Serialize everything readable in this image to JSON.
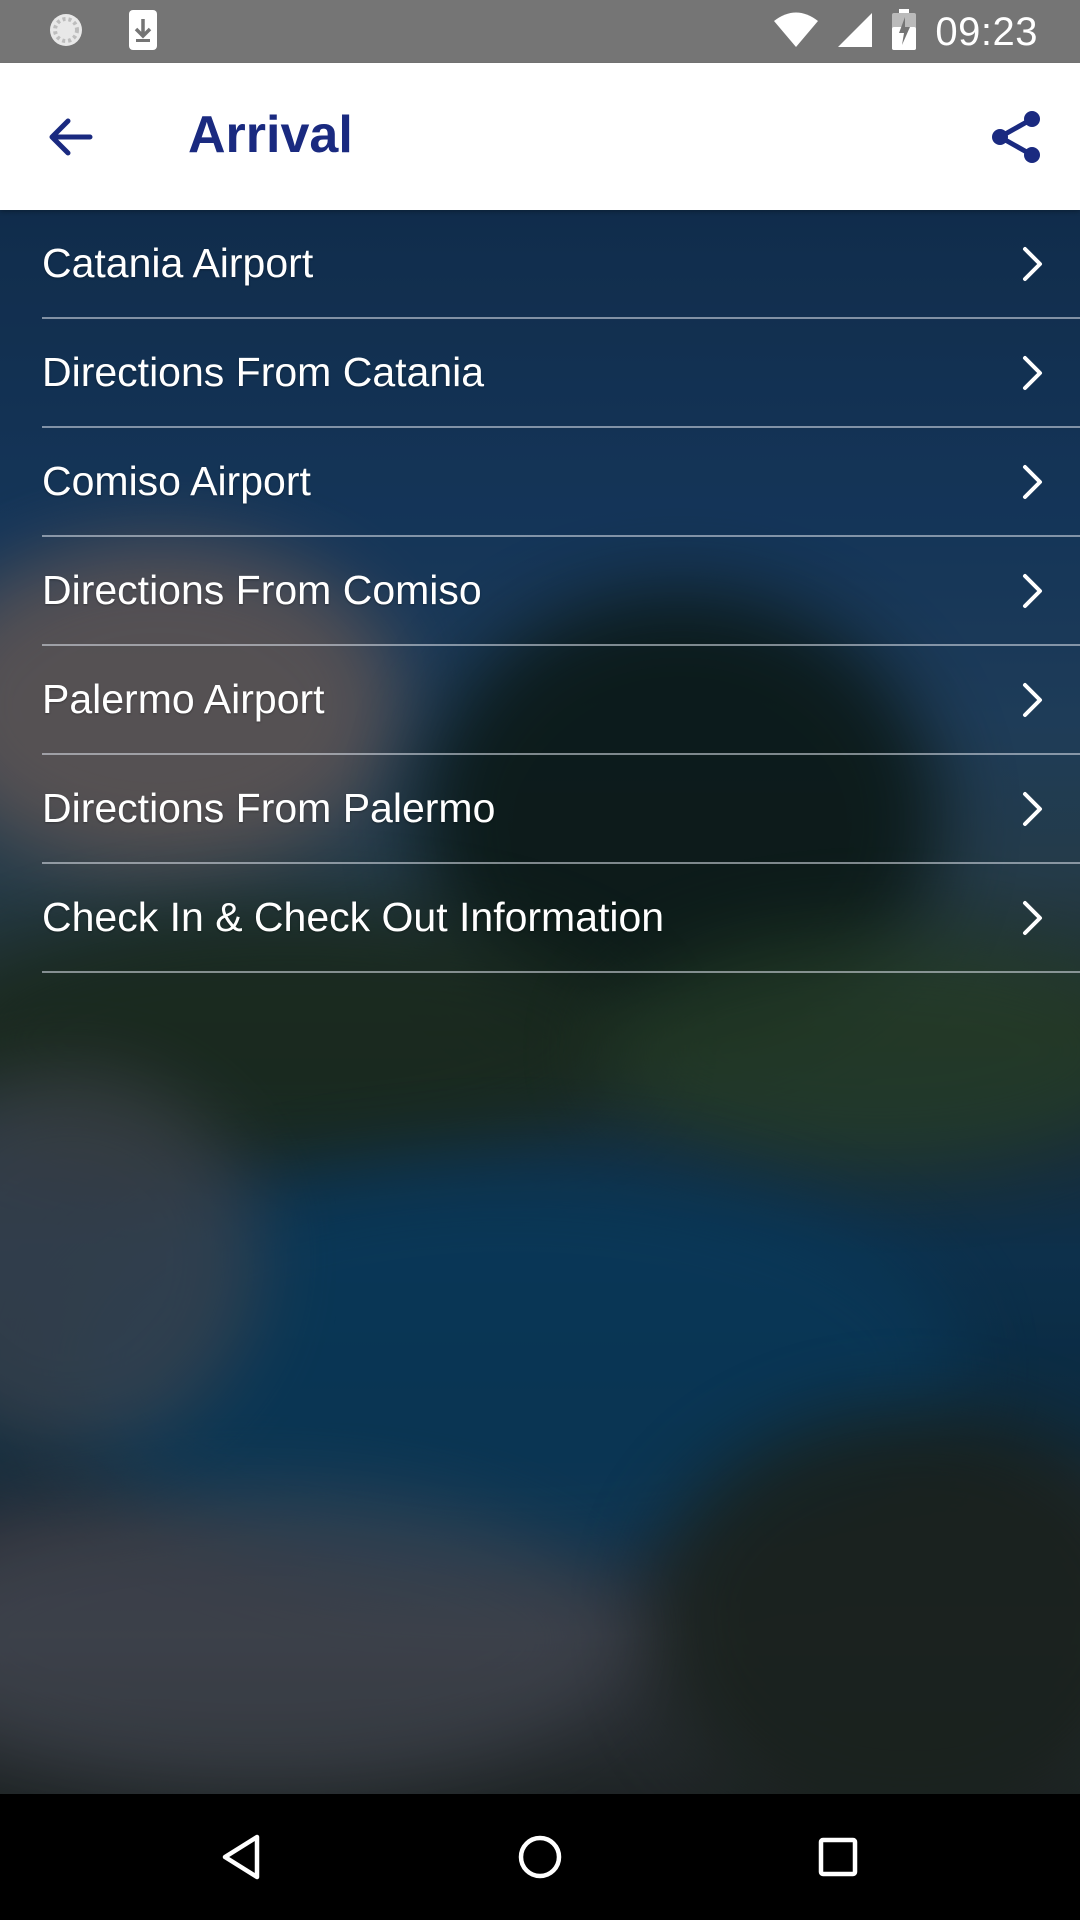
{
  "status_bar": {
    "time": "09:23",
    "icons": [
      "sync-icon",
      "download-icon",
      "wifi-icon",
      "signal-icon",
      "battery-icon"
    ]
  },
  "app_bar": {
    "title": "Arrival",
    "back_icon": "arrow-back-icon",
    "share_icon": "share-icon",
    "color": "#1a2a80"
  },
  "menu": {
    "items": [
      {
        "label": "Catania Airport"
      },
      {
        "label": "Directions From Catania"
      },
      {
        "label": "Comiso Airport"
      },
      {
        "label": "Directions From Comiso"
      },
      {
        "label": "Palermo Airport"
      },
      {
        "label": "Directions From Palermo"
      },
      {
        "label": "Check In & Check Out Information"
      }
    ],
    "chevron_icon": "chevron-right-icon"
  },
  "nav_bar": {
    "icons": [
      "back-triangle-icon",
      "home-circle-icon",
      "recents-square-icon"
    ]
  }
}
